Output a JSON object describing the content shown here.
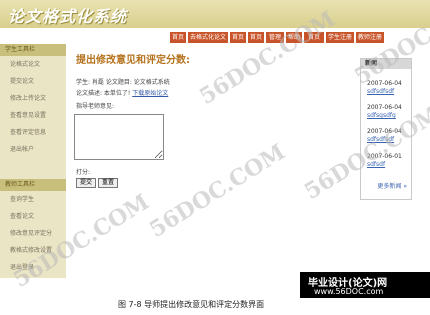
{
  "app": {
    "title": "论文格式化系统"
  },
  "nav": [
    "首页",
    "去格式化论文",
    "首页",
    "首页",
    "管理",
    "帮助",
    "首页",
    "学生注册",
    "教师注册"
  ],
  "sidebar": {
    "student_tools": {
      "heading": "学生工具栏",
      "items": [
        "论格式论文",
        "提交论文",
        "修改上传论文",
        "查看意见设置",
        "查看评定信息",
        "退出帐户"
      ]
    },
    "teacher_tools": {
      "heading": "教师工具栏",
      "items": [
        "查询学生",
        "查看论文",
        "修改意见评定分",
        "教格式修改设置",
        "退出登录"
      ]
    }
  },
  "main": {
    "title": "提出修改意见和评定分数:",
    "line1": "学生: 肖磊  论文题目: 论文格式系统",
    "line2_text": "论文描述: 本单位了!  ",
    "line2_link": "下载原始论文",
    "line3": "指导老师意见:",
    "score_label": "打分:",
    "score_value": "",
    "comment_value": "",
    "submit_label": "提交",
    "reset_label": "重置"
  },
  "news": {
    "heading": "新闻",
    "items": [
      {
        "date": "2007-06-04",
        "title": "sdfsdfsdf"
      },
      {
        "date": "2007-06-04",
        "title": "sdfsgsdfg"
      },
      {
        "date": "2007-06-04",
        "title": "sdfsdfsdf"
      },
      {
        "date": "2007-06-01",
        "title": "sdfsdf"
      }
    ],
    "more_label": "更多新闻 »"
  },
  "watermark": "56DOC.COM",
  "banner": {
    "line1": "毕业设计(论文)网",
    "line2": "www.56DOC.com"
  },
  "caption": "图 7-8  导师提出修改意见和评定分数界面",
  "colors": {
    "header": "#d9cf8e",
    "nav_tab": "#c8552a",
    "sidebar": "#eae5c5",
    "sidebar_heading": "#c9bf7d",
    "title": "#b5721c",
    "link": "#3a63b0"
  }
}
